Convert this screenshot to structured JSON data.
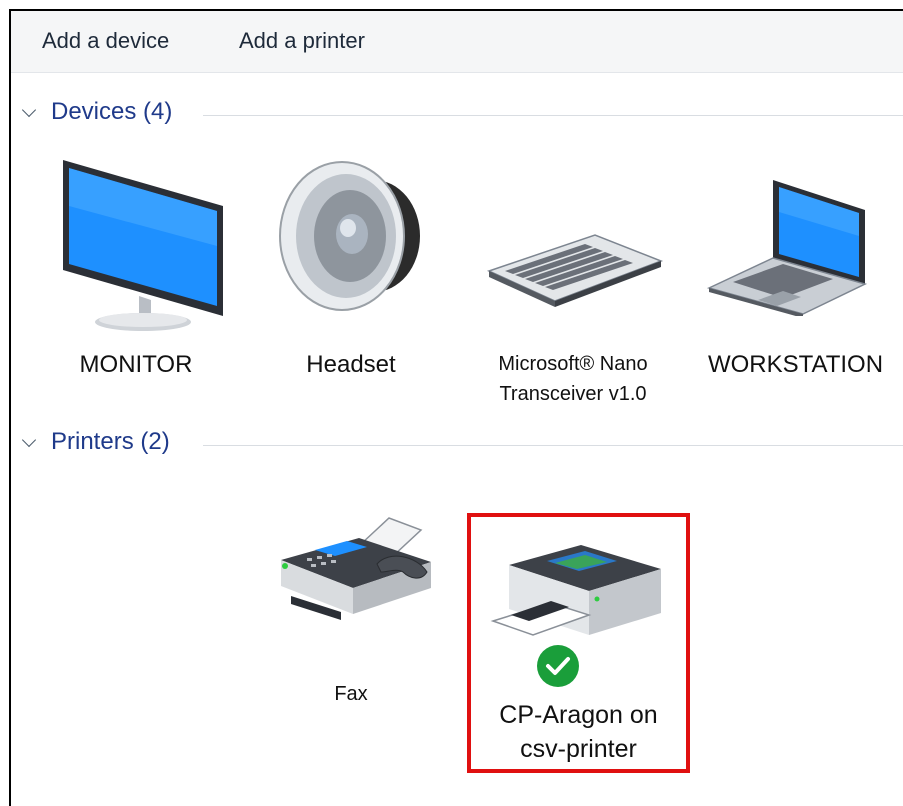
{
  "toolbar": {
    "add_device": "Add a device",
    "add_printer": "Add a printer"
  },
  "groups": {
    "devices": {
      "title": "Devices (4)"
    },
    "printers": {
      "title": "Printers (2)"
    }
  },
  "devices": [
    {
      "label": "MONITOR",
      "icon": "monitor-icon"
    },
    {
      "label": "Headset",
      "icon": "speaker-icon"
    },
    {
      "label_line1": "Microsoft® Nano",
      "label_line2": "Transceiver v1.0",
      "icon": "keyboard-icon"
    },
    {
      "label": "WORKSTATION",
      "icon": "laptop-icon"
    }
  ],
  "printers": [
    {
      "label": "Fax",
      "icon": "fax-icon"
    },
    {
      "label_line1": "CP-Aragon on",
      "label_line2": "csv-printer",
      "icon": "printer-icon",
      "default": true
    }
  ],
  "colors": {
    "group_title": "#1f3a8a",
    "selection_border": "#e01010",
    "default_check": "#1a9e3a"
  }
}
